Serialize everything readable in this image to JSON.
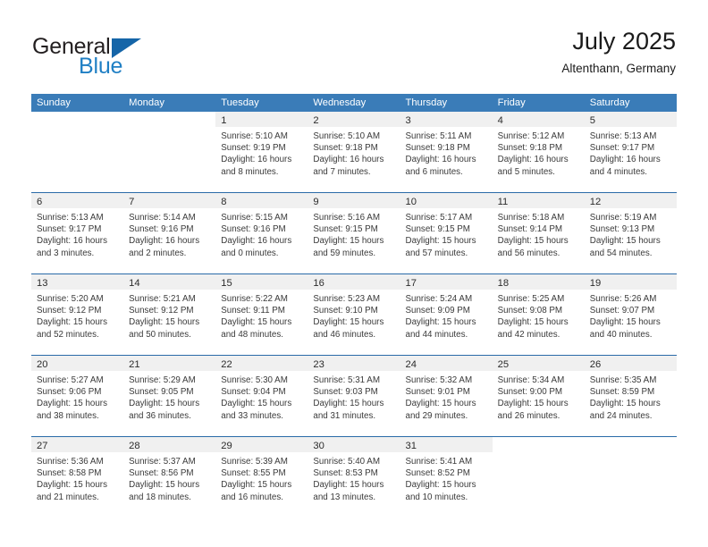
{
  "brand": {
    "name_part1": "General",
    "name_part2": "Blue"
  },
  "header": {
    "title": "July 2025",
    "subtitle": "Altenthann, Germany"
  },
  "colors": {
    "header_blue": "#3a7cb8",
    "rule_blue": "#2a6ba8",
    "brand_blue": "#1f7fc4",
    "logo_triangle": "#1565a8",
    "day_band_gray": "#f0f0f0"
  },
  "weekdays": [
    "Sunday",
    "Monday",
    "Tuesday",
    "Wednesday",
    "Thursday",
    "Friday",
    "Saturday"
  ],
  "weeks": [
    [
      {
        "day": "",
        "sunrise": "",
        "sunset": "",
        "daylight1": "",
        "daylight2": ""
      },
      {
        "day": "",
        "sunrise": "",
        "sunset": "",
        "daylight1": "",
        "daylight2": ""
      },
      {
        "day": "1",
        "sunrise": "Sunrise: 5:10 AM",
        "sunset": "Sunset: 9:19 PM",
        "daylight1": "Daylight: 16 hours",
        "daylight2": "and 8 minutes."
      },
      {
        "day": "2",
        "sunrise": "Sunrise: 5:10 AM",
        "sunset": "Sunset: 9:18 PM",
        "daylight1": "Daylight: 16 hours",
        "daylight2": "and 7 minutes."
      },
      {
        "day": "3",
        "sunrise": "Sunrise: 5:11 AM",
        "sunset": "Sunset: 9:18 PM",
        "daylight1": "Daylight: 16 hours",
        "daylight2": "and 6 minutes."
      },
      {
        "day": "4",
        "sunrise": "Sunrise: 5:12 AM",
        "sunset": "Sunset: 9:18 PM",
        "daylight1": "Daylight: 16 hours",
        "daylight2": "and 5 minutes."
      },
      {
        "day": "5",
        "sunrise": "Sunrise: 5:13 AM",
        "sunset": "Sunset: 9:17 PM",
        "daylight1": "Daylight: 16 hours",
        "daylight2": "and 4 minutes."
      }
    ],
    [
      {
        "day": "6",
        "sunrise": "Sunrise: 5:13 AM",
        "sunset": "Sunset: 9:17 PM",
        "daylight1": "Daylight: 16 hours",
        "daylight2": "and 3 minutes."
      },
      {
        "day": "7",
        "sunrise": "Sunrise: 5:14 AM",
        "sunset": "Sunset: 9:16 PM",
        "daylight1": "Daylight: 16 hours",
        "daylight2": "and 2 minutes."
      },
      {
        "day": "8",
        "sunrise": "Sunrise: 5:15 AM",
        "sunset": "Sunset: 9:16 PM",
        "daylight1": "Daylight: 16 hours",
        "daylight2": "and 0 minutes."
      },
      {
        "day": "9",
        "sunrise": "Sunrise: 5:16 AM",
        "sunset": "Sunset: 9:15 PM",
        "daylight1": "Daylight: 15 hours",
        "daylight2": "and 59 minutes."
      },
      {
        "day": "10",
        "sunrise": "Sunrise: 5:17 AM",
        "sunset": "Sunset: 9:15 PM",
        "daylight1": "Daylight: 15 hours",
        "daylight2": "and 57 minutes."
      },
      {
        "day": "11",
        "sunrise": "Sunrise: 5:18 AM",
        "sunset": "Sunset: 9:14 PM",
        "daylight1": "Daylight: 15 hours",
        "daylight2": "and 56 minutes."
      },
      {
        "day": "12",
        "sunrise": "Sunrise: 5:19 AM",
        "sunset": "Sunset: 9:13 PM",
        "daylight1": "Daylight: 15 hours",
        "daylight2": "and 54 minutes."
      }
    ],
    [
      {
        "day": "13",
        "sunrise": "Sunrise: 5:20 AM",
        "sunset": "Sunset: 9:12 PM",
        "daylight1": "Daylight: 15 hours",
        "daylight2": "and 52 minutes."
      },
      {
        "day": "14",
        "sunrise": "Sunrise: 5:21 AM",
        "sunset": "Sunset: 9:12 PM",
        "daylight1": "Daylight: 15 hours",
        "daylight2": "and 50 minutes."
      },
      {
        "day": "15",
        "sunrise": "Sunrise: 5:22 AM",
        "sunset": "Sunset: 9:11 PM",
        "daylight1": "Daylight: 15 hours",
        "daylight2": "and 48 minutes."
      },
      {
        "day": "16",
        "sunrise": "Sunrise: 5:23 AM",
        "sunset": "Sunset: 9:10 PM",
        "daylight1": "Daylight: 15 hours",
        "daylight2": "and 46 minutes."
      },
      {
        "day": "17",
        "sunrise": "Sunrise: 5:24 AM",
        "sunset": "Sunset: 9:09 PM",
        "daylight1": "Daylight: 15 hours",
        "daylight2": "and 44 minutes."
      },
      {
        "day": "18",
        "sunrise": "Sunrise: 5:25 AM",
        "sunset": "Sunset: 9:08 PM",
        "daylight1": "Daylight: 15 hours",
        "daylight2": "and 42 minutes."
      },
      {
        "day": "19",
        "sunrise": "Sunrise: 5:26 AM",
        "sunset": "Sunset: 9:07 PM",
        "daylight1": "Daylight: 15 hours",
        "daylight2": "and 40 minutes."
      }
    ],
    [
      {
        "day": "20",
        "sunrise": "Sunrise: 5:27 AM",
        "sunset": "Sunset: 9:06 PM",
        "daylight1": "Daylight: 15 hours",
        "daylight2": "and 38 minutes."
      },
      {
        "day": "21",
        "sunrise": "Sunrise: 5:29 AM",
        "sunset": "Sunset: 9:05 PM",
        "daylight1": "Daylight: 15 hours",
        "daylight2": "and 36 minutes."
      },
      {
        "day": "22",
        "sunrise": "Sunrise: 5:30 AM",
        "sunset": "Sunset: 9:04 PM",
        "daylight1": "Daylight: 15 hours",
        "daylight2": "and 33 minutes."
      },
      {
        "day": "23",
        "sunrise": "Sunrise: 5:31 AM",
        "sunset": "Sunset: 9:03 PM",
        "daylight1": "Daylight: 15 hours",
        "daylight2": "and 31 minutes."
      },
      {
        "day": "24",
        "sunrise": "Sunrise: 5:32 AM",
        "sunset": "Sunset: 9:01 PM",
        "daylight1": "Daylight: 15 hours",
        "daylight2": "and 29 minutes."
      },
      {
        "day": "25",
        "sunrise": "Sunrise: 5:34 AM",
        "sunset": "Sunset: 9:00 PM",
        "daylight1": "Daylight: 15 hours",
        "daylight2": "and 26 minutes."
      },
      {
        "day": "26",
        "sunrise": "Sunrise: 5:35 AM",
        "sunset": "Sunset: 8:59 PM",
        "daylight1": "Daylight: 15 hours",
        "daylight2": "and 24 minutes."
      }
    ],
    [
      {
        "day": "27",
        "sunrise": "Sunrise: 5:36 AM",
        "sunset": "Sunset: 8:58 PM",
        "daylight1": "Daylight: 15 hours",
        "daylight2": "and 21 minutes."
      },
      {
        "day": "28",
        "sunrise": "Sunrise: 5:37 AM",
        "sunset": "Sunset: 8:56 PM",
        "daylight1": "Daylight: 15 hours",
        "daylight2": "and 18 minutes."
      },
      {
        "day": "29",
        "sunrise": "Sunrise: 5:39 AM",
        "sunset": "Sunset: 8:55 PM",
        "daylight1": "Daylight: 15 hours",
        "daylight2": "and 16 minutes."
      },
      {
        "day": "30",
        "sunrise": "Sunrise: 5:40 AM",
        "sunset": "Sunset: 8:53 PM",
        "daylight1": "Daylight: 15 hours",
        "daylight2": "and 13 minutes."
      },
      {
        "day": "31",
        "sunrise": "Sunrise: 5:41 AM",
        "sunset": "Sunset: 8:52 PM",
        "daylight1": "Daylight: 15 hours",
        "daylight2": "and 10 minutes."
      },
      {
        "day": "",
        "sunrise": "",
        "sunset": "",
        "daylight1": "",
        "daylight2": ""
      },
      {
        "day": "",
        "sunrise": "",
        "sunset": "",
        "daylight1": "",
        "daylight2": ""
      }
    ]
  ]
}
